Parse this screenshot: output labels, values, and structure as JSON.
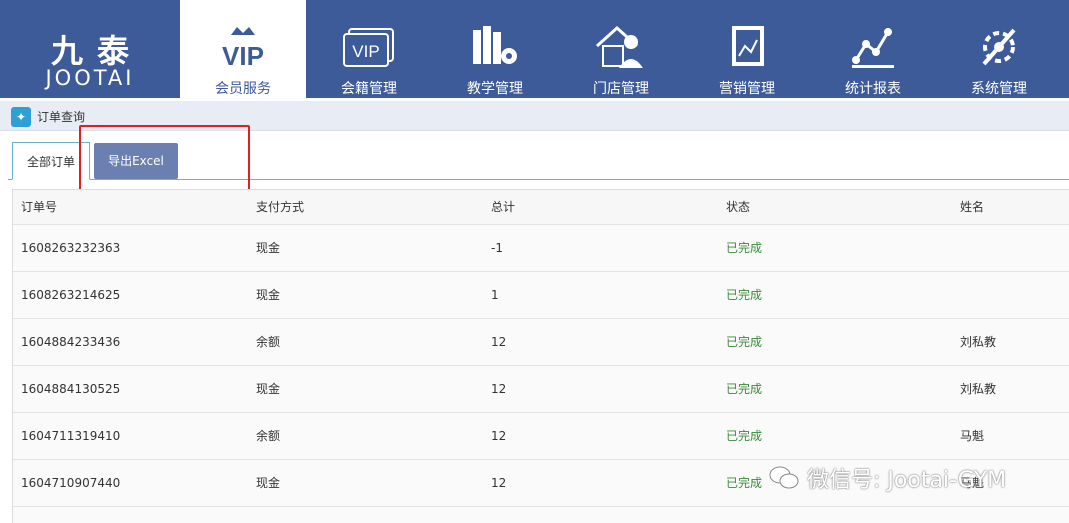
{
  "brand": {
    "name_cn": "九泰",
    "name_en": "JOOTAI"
  },
  "nav": [
    {
      "label": "会员服务",
      "icon": "vip-crown-icon",
      "active": true
    },
    {
      "label": "会籍管理",
      "icon": "vip-card-icon"
    },
    {
      "label": "教学管理",
      "icon": "books-gear-icon"
    },
    {
      "label": "门店管理",
      "icon": "house-person-icon"
    },
    {
      "label": "营销管理",
      "icon": "chart-doc-icon"
    },
    {
      "label": "统计报表",
      "icon": "line-chart-icon"
    },
    {
      "label": "系统管理",
      "icon": "wrench-gear-icon"
    }
  ],
  "breadcrumb": {
    "icon": "order-icon",
    "label": "订单查询"
  },
  "tabs": {
    "all_label": "全部订单",
    "export_label": "导出Excel"
  },
  "table": {
    "headers": [
      "订单号",
      "支付方式",
      "总计",
      "状态",
      "姓名"
    ],
    "rows": [
      [
        "1608263232363",
        "现金",
        "-1",
        "已完成",
        ""
      ],
      [
        "1608263214625",
        "现金",
        "1",
        "已完成",
        ""
      ],
      [
        "1604884233436",
        "余额",
        "12",
        "已完成",
        "刘私教"
      ],
      [
        "1604884130525",
        "现金",
        "12",
        "已完成",
        "刘私教"
      ],
      [
        "1604711319410",
        "余额",
        "12",
        "已完成",
        "马魁"
      ],
      [
        "1604710907440",
        "现金",
        "12",
        "已完成",
        "马魁"
      ]
    ]
  },
  "watermark": {
    "text": "微信号: Jootai-GYM"
  },
  "colors": {
    "nav_bg": "#3d5a99",
    "export_btn": "#6b7fb1",
    "status_done": "#3a8a3a",
    "highlight": "#e02020"
  }
}
